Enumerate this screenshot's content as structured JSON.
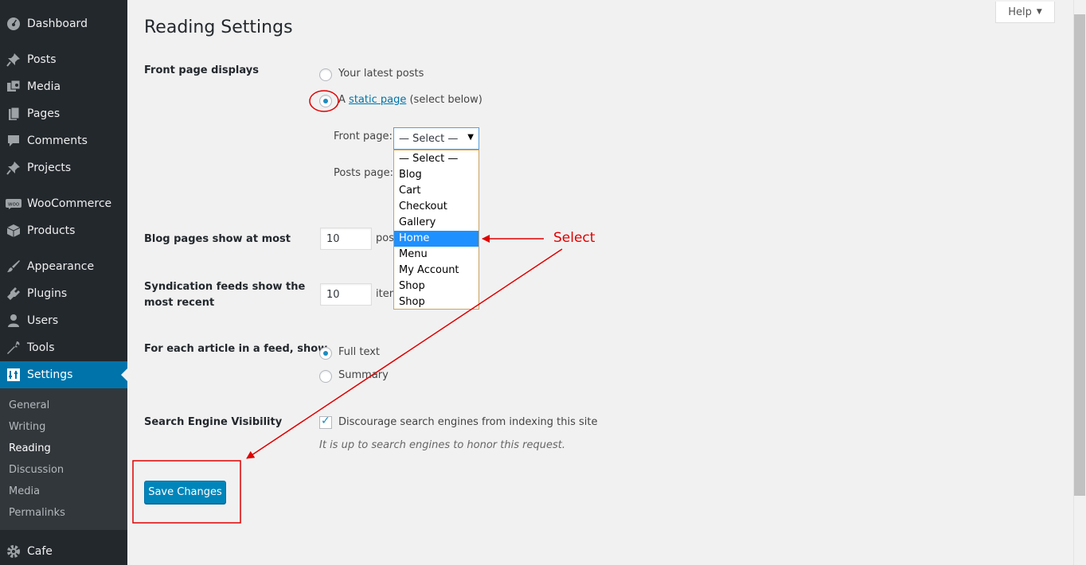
{
  "sidebar": {
    "items": [
      {
        "label": "Dashboard",
        "icon": "dashboard-icon"
      },
      {
        "label": "Posts",
        "icon": "pin-icon"
      },
      {
        "label": "Media",
        "icon": "media-icon"
      },
      {
        "label": "Pages",
        "icon": "pages-icon"
      },
      {
        "label": "Comments",
        "icon": "comment-icon"
      },
      {
        "label": "Projects",
        "icon": "pin-icon"
      },
      {
        "label": "WooCommerce",
        "icon": "woo-icon"
      },
      {
        "label": "Products",
        "icon": "box-icon"
      },
      {
        "label": "Appearance",
        "icon": "brush-icon"
      },
      {
        "label": "Plugins",
        "icon": "plug-icon"
      },
      {
        "label": "Users",
        "icon": "user-icon"
      },
      {
        "label": "Tools",
        "icon": "wrench-icon"
      },
      {
        "label": "Settings",
        "icon": "settings-icon"
      },
      {
        "label": "Cafe",
        "icon": "gear-icon"
      }
    ],
    "woo_badge": "woo",
    "submenu": [
      "General",
      "Writing",
      "Reading",
      "Discussion",
      "Media",
      "Permalinks"
    ],
    "colors": {
      "bg": "#23282d",
      "current": "#0073aa",
      "submenu_bg": "#32373c"
    }
  },
  "header": {
    "title": "Reading Settings",
    "help_label": "Help"
  },
  "form": {
    "front_page_displays": {
      "label": "Front page displays",
      "option_latest": "Your latest posts",
      "option_static_prefix": "A",
      "option_static_link": "static page",
      "option_static_suffix": "(select below)",
      "front_page_label": "Front page:",
      "posts_page_label": "Posts page:",
      "front_select_value": "— Select —",
      "dropdown_options": [
        "— Select —",
        "Blog",
        "Cart",
        "Checkout",
        "Gallery",
        "Home",
        "Menu",
        "My Account",
        "Shop",
        "Shop"
      ],
      "highlighted_option": "Home"
    },
    "blog_pages": {
      "label": "Blog pages show at most",
      "value": "10",
      "unit": "posts"
    },
    "syndication": {
      "label_line1": "Syndication feeds show the",
      "label_line2": "most recent",
      "value": "10",
      "unit": "items"
    },
    "feed_article": {
      "label": "For each article in a feed, show",
      "option_full": "Full text",
      "option_summary": "Summary"
    },
    "search_visibility": {
      "label": "Search Engine Visibility",
      "checkbox_label": "Discourage search engines from indexing this site",
      "checked": true,
      "hint": "It is up to search engines to honor this request."
    },
    "save_label": "Save Changes"
  },
  "annotation": {
    "text": "Select",
    "color": "#e00000"
  }
}
